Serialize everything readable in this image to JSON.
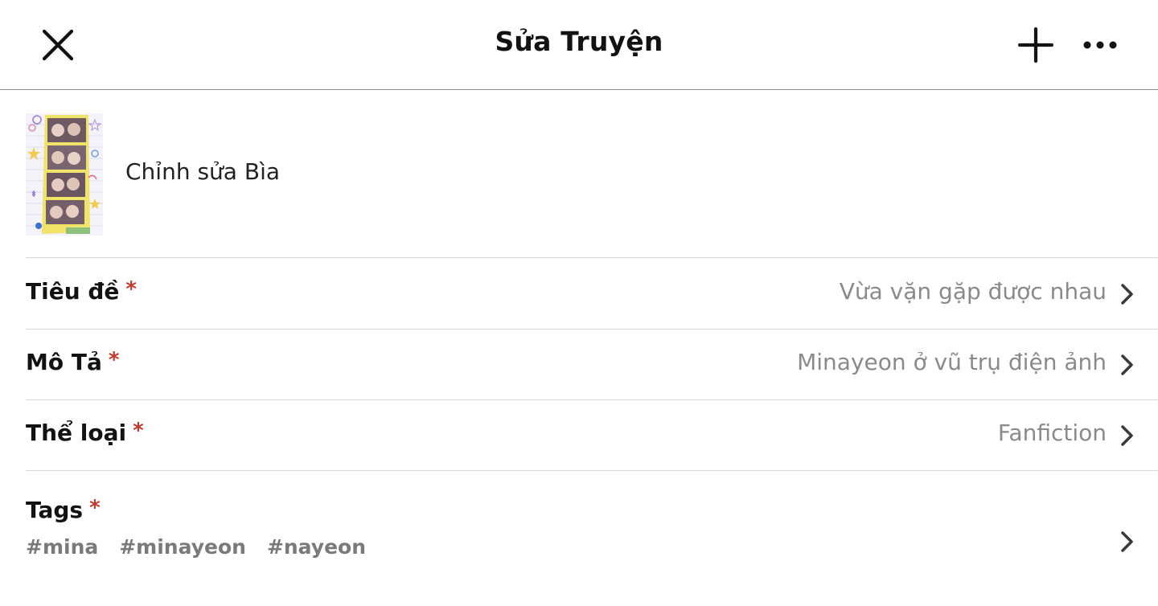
{
  "header": {
    "title": "Sửa Truyện",
    "close_icon": "close-icon",
    "add_icon": "plus-icon",
    "more_icon": "more-horizontal-icon"
  },
  "cover": {
    "label": "Chỉnh sửa Bìa",
    "thumbnail": "photo-strip-cover-image"
  },
  "fields": [
    {
      "label": "Tiêu đề",
      "required_mark": "*",
      "value": "Vừa vặn gặp được nhau"
    },
    {
      "label": "Mô Tả",
      "required_mark": "*",
      "value": "Minayeon ở vũ trụ điện ảnh"
    },
    {
      "label": "Thể loại",
      "required_mark": "*",
      "value": "Fanfiction"
    }
  ],
  "tags": {
    "label": "Tags",
    "required_mark": "*",
    "items": [
      "#mina",
      "#minayeon",
      "#nayeon"
    ]
  },
  "colors": {
    "required": "#c0392b",
    "value_text": "#8a8a8a",
    "divider": "#d6d6d6"
  }
}
